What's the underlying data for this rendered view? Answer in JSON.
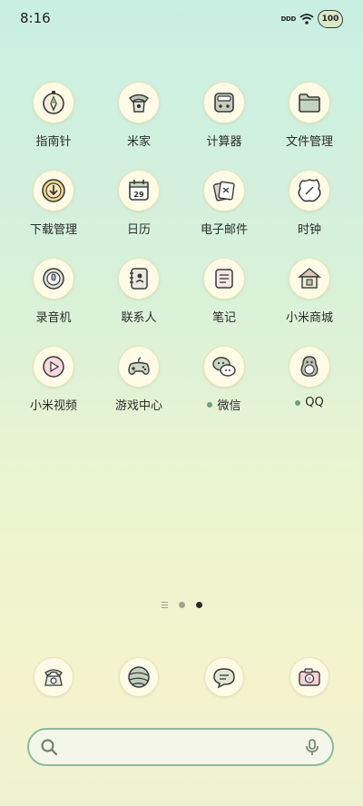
{
  "status": {
    "time": "8:16",
    "battery_text": "100",
    "network_text": "DDD"
  },
  "apps": [
    {
      "label": "指南针",
      "icon": "compass-icon",
      "has_dot": false
    },
    {
      "label": "米家",
      "icon": "mijia-icon",
      "has_dot": false
    },
    {
      "label": "计算器",
      "icon": "calculator-icon",
      "has_dot": false
    },
    {
      "label": "文件管理",
      "icon": "folder-icon",
      "has_dot": false
    },
    {
      "label": "下载管理",
      "icon": "download-icon",
      "has_dot": false
    },
    {
      "label": "日历",
      "icon": "calendar-icon",
      "has_dot": false,
      "calendar_day": "29"
    },
    {
      "label": "电子邮件",
      "icon": "email-icon",
      "has_dot": false
    },
    {
      "label": "时钟",
      "icon": "clock-icon",
      "has_dot": false
    },
    {
      "label": "录音机",
      "icon": "recorder-icon",
      "has_dot": false
    },
    {
      "label": "联系人",
      "icon": "contacts-icon",
      "has_dot": false
    },
    {
      "label": "笔记",
      "icon": "notes-icon",
      "has_dot": false
    },
    {
      "label": "小米商城",
      "icon": "store-icon",
      "has_dot": false
    },
    {
      "label": "小米视频",
      "icon": "video-icon",
      "has_dot": false
    },
    {
      "label": "游戏中心",
      "icon": "gamepad-icon",
      "has_dot": false
    },
    {
      "label": "微信",
      "icon": "wechat-icon",
      "has_dot": true
    },
    {
      "label": "QQ",
      "icon": "qq-penguin-icon",
      "has_dot": true
    }
  ],
  "pager": {
    "pages": 3,
    "active_index": 2
  },
  "dock": [
    {
      "icon": "phone-icon"
    },
    {
      "icon": "browser-icon"
    },
    {
      "icon": "messages-icon"
    },
    {
      "icon": "camera-icon"
    }
  ],
  "search": {
    "placeholder": "",
    "value": ""
  },
  "colors": {
    "accent_dot": "#6ba27a",
    "search_border": "#8fb79e",
    "icon_bg": "#fffbe6"
  }
}
